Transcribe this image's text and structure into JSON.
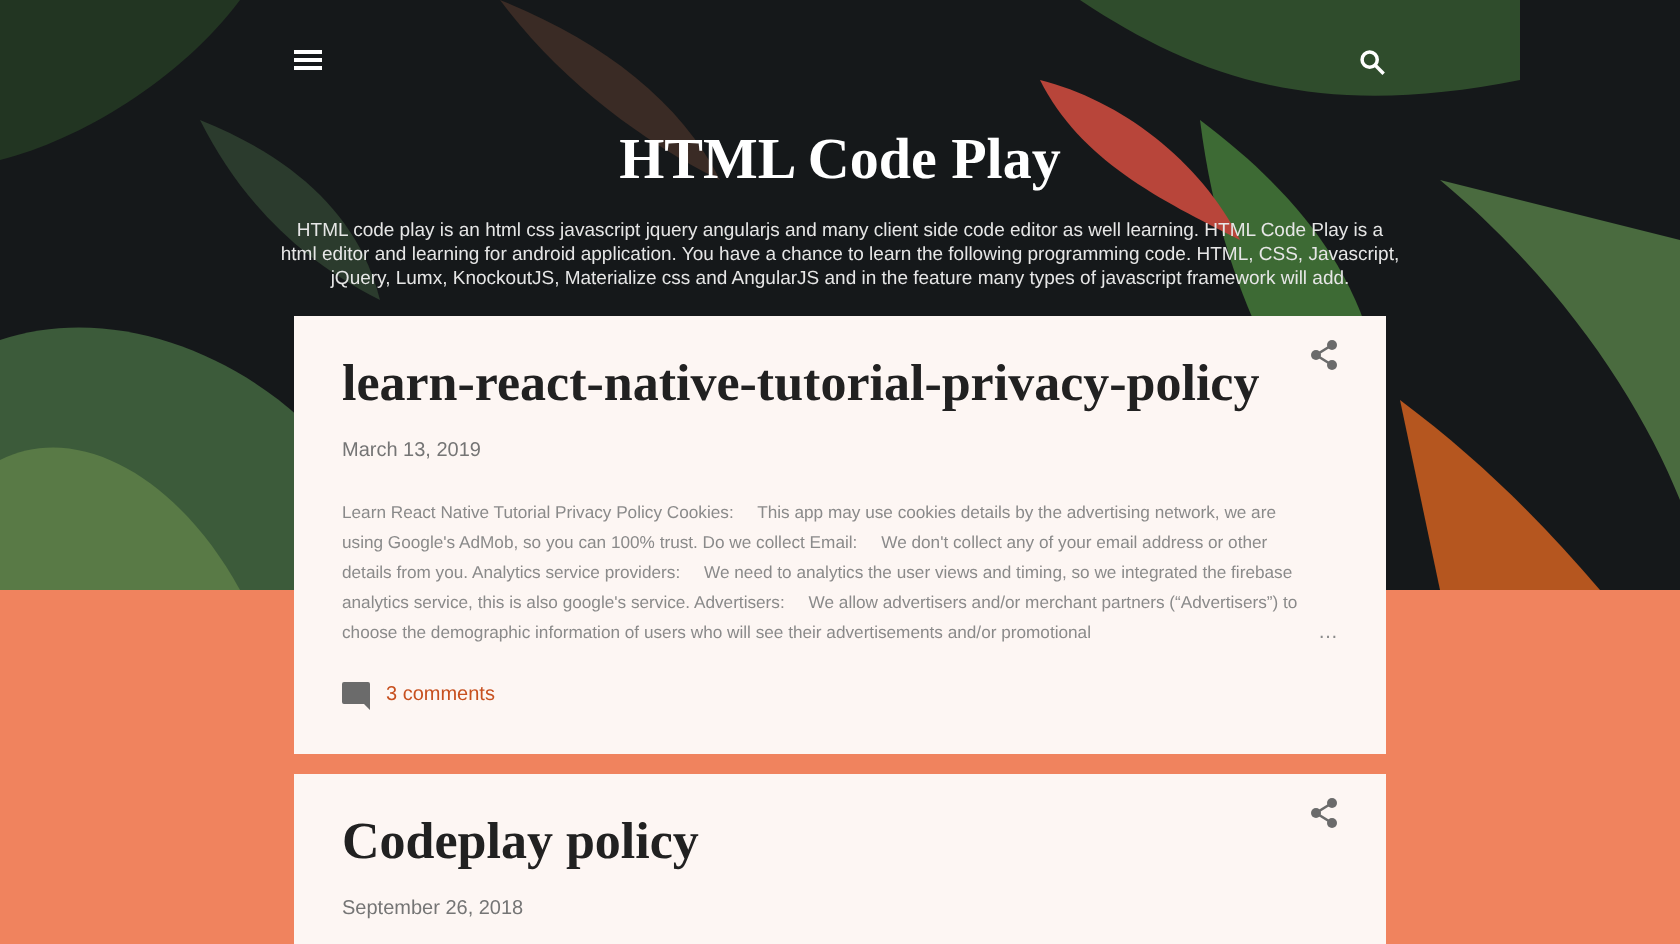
{
  "header": {
    "title": "HTML Code Play",
    "description": "HTML code play is an html css javascript jquery angularjs and many client side code editor as well learning. HTML Code Play is a html editor and learning for android application. You have a chance to learn the following programming code. HTML, CSS, Javascript, jQuery, Lumx, KnockoutJS, Materialize css and AngularJS and in the feature many types of javascript framework will add."
  },
  "posts": [
    {
      "title": "learn-react-native-tutorial-privacy-policy",
      "date": "March 13, 2019",
      "snippet": "Learn React Native Tutorial Privacy Policy Cookies:     This app may use cookies details by the advertising network, we are using Google's AdMob, so you can 100% trust. Do we collect Email:     We don't collect any of your email address or other details from you. Analytics service providers:     We need to analytics the user views and timing, so we integrated the firebase analytics service, this is also google's service. Advertisers:     We allow advertisers and/or merchant partners (“Advertisers”) to choose the demographic information of users who will see their advertisements and/or promotional",
      "more": "…",
      "comments": "3 comments"
    },
    {
      "title": "Codeplay policy",
      "date": "September 26, 2018"
    }
  ]
}
